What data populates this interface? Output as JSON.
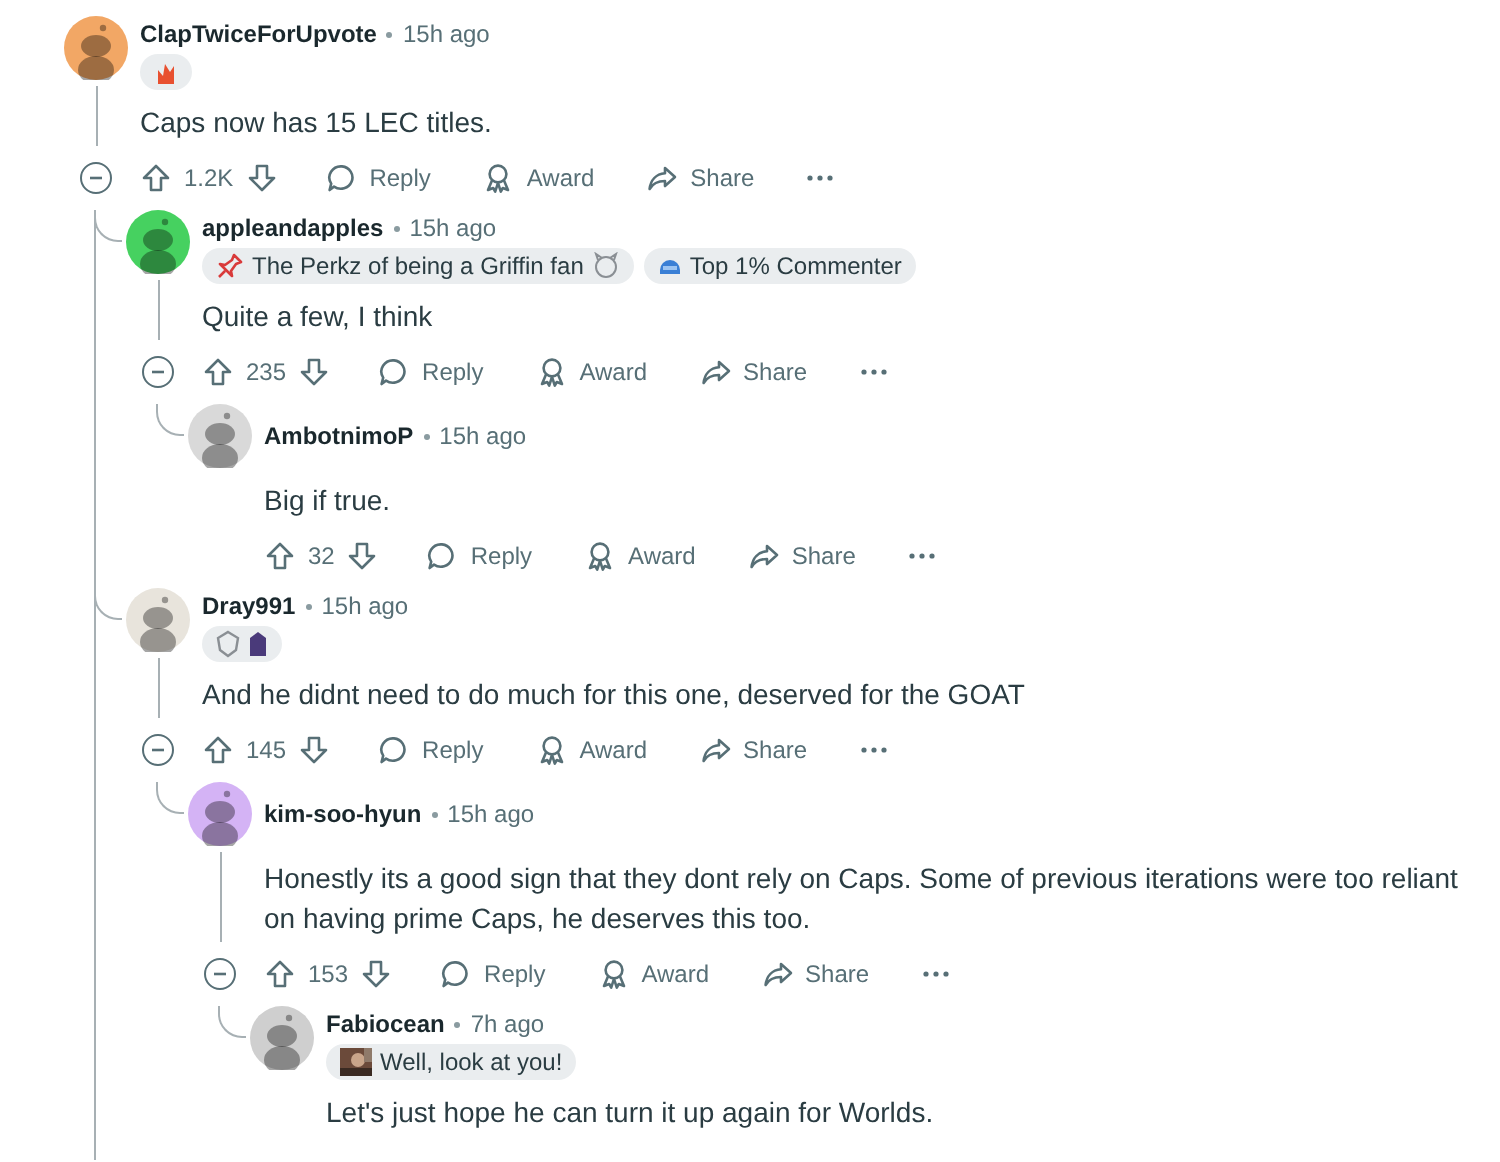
{
  "comments": [
    {
      "author": "ClapTwiceForUpvote",
      "time": "15h ago",
      "color": "#f2a765",
      "flairs": [
        {
          "kind": "flame"
        }
      ],
      "body": "Caps now has 15 LEC titles.",
      "expanded": true,
      "score": "1.2K",
      "actions": [
        {
          "kind": "reply",
          "label": "Reply"
        },
        {
          "kind": "award",
          "label": "Award"
        },
        {
          "kind": "share",
          "label": "Share"
        }
      ],
      "children": [
        {
          "author": "appleandapples",
          "time": "15h ago",
          "color": "#46d160",
          "flairs": [
            {
              "kind": "pin",
              "text": "The Perkz of being a Griffin fan"
            },
            {
              "kind": "helmet",
              "text": "Top 1% Commenter"
            }
          ],
          "body": "Quite a few, I think",
          "expanded": true,
          "score": "235",
          "actions": [
            {
              "kind": "reply",
              "label": "Reply"
            },
            {
              "kind": "award",
              "label": "Award"
            },
            {
              "kind": "share",
              "label": "Share"
            }
          ],
          "children": [
            {
              "author": "AmbotnimoP",
              "time": "15h ago",
              "color": "#d9d9d9",
              "body": "Big if true.",
              "score": "32",
              "actions": [
                {
                  "kind": "reply",
                  "label": "Reply"
                },
                {
                  "kind": "award",
                  "label": "Award"
                },
                {
                  "kind": "share",
                  "label": "Share"
                }
              ]
            }
          ]
        },
        {
          "author": "Dray991",
          "time": "15h ago",
          "color": "#e8e4dc",
          "flairs": [
            {
              "kind": "emblems"
            }
          ],
          "body": "And he didnt need to do much for this one, deserved for the GOAT",
          "expanded": true,
          "score": "145",
          "actions": [
            {
              "kind": "reply",
              "label": "Reply"
            },
            {
              "kind": "award",
              "label": "Award"
            },
            {
              "kind": "share",
              "label": "Share"
            }
          ],
          "children": [
            {
              "author": "kim-soo-hyun",
              "time": "15h ago",
              "color": "#d4b3f5",
              "body": "Honestly its a good sign that they dont rely on Caps. Some of previous iterations were too reliant on having prime Caps, he deserves this too.",
              "expanded": true,
              "score": "153",
              "actions": [
                {
                  "kind": "reply",
                  "label": "Reply"
                },
                {
                  "kind": "award",
                  "label": "Award"
                },
                {
                  "kind": "share",
                  "label": "Share"
                }
              ],
              "children": [
                {
                  "author": "Fabiocean",
                  "time": "7h ago",
                  "color": "#cfcfcf",
                  "flairs": [
                    {
                      "text": "Well, look at you!"
                    }
                  ],
                  "body": "Let's just hope he can turn it up again for Worlds."
                }
              ]
            }
          ]
        }
      ]
    }
  ]
}
